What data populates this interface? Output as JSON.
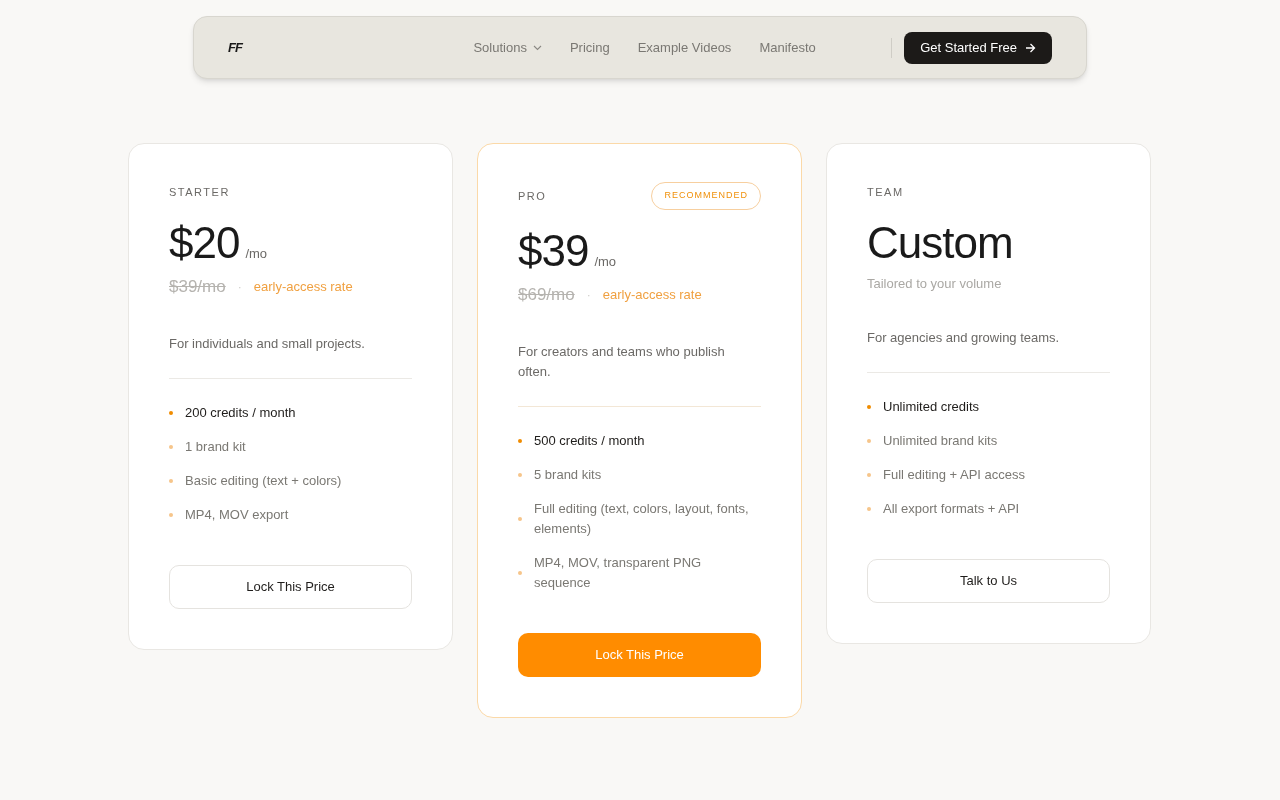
{
  "nav": {
    "logo": "FF",
    "links": [
      {
        "label": "Solutions",
        "dropdown": true
      },
      {
        "label": "Pricing",
        "dropdown": false
      },
      {
        "label": "Example Videos",
        "dropdown": false
      },
      {
        "label": "Manifesto",
        "dropdown": false
      }
    ],
    "cta": "Get Started Free"
  },
  "plans": [
    {
      "name": "STARTER",
      "featured": false,
      "price": "$20",
      "period": "/mo",
      "old_price": "$39/mo",
      "sep": "·",
      "note": "early-access rate",
      "description": "For individuals and small projects.",
      "features": [
        {
          "text": "200 credits / month",
          "emphasized": true
        },
        {
          "text": "1 brand kit",
          "emphasized": false
        },
        {
          "text": "Basic editing (text + colors)",
          "emphasized": false
        },
        {
          "text": "MP4, MOV export",
          "emphasized": false
        }
      ],
      "button": "Lock This Price"
    },
    {
      "name": "PRO",
      "featured": true,
      "badge": "RECOMMENDED",
      "price": "$39",
      "period": "/mo",
      "old_price": "$69/mo",
      "sep": "·",
      "note": "early-access rate",
      "description": "For creators and teams who publish often.",
      "features": [
        {
          "text": "500 credits / month",
          "emphasized": true
        },
        {
          "text": "5 brand kits",
          "emphasized": false
        },
        {
          "text": "Full editing (text, colors, layout, fonts, elements)",
          "emphasized": false
        },
        {
          "text": "MP4, MOV, transparent PNG sequence",
          "emphasized": false
        }
      ],
      "button": "Lock This Price"
    },
    {
      "name": "TEAM",
      "featured": false,
      "price": "Custom",
      "subtitle": "Tailored to your volume",
      "description": "For agencies and growing teams.",
      "features": [
        {
          "text": "Unlimited credits",
          "emphasized": true
        },
        {
          "text": "Unlimited brand kits",
          "emphasized": false
        },
        {
          "text": "Full editing + API access",
          "emphasized": false
        },
        {
          "text": "All export formats + API",
          "emphasized": false
        }
      ],
      "button": "Talk to Us"
    }
  ]
}
